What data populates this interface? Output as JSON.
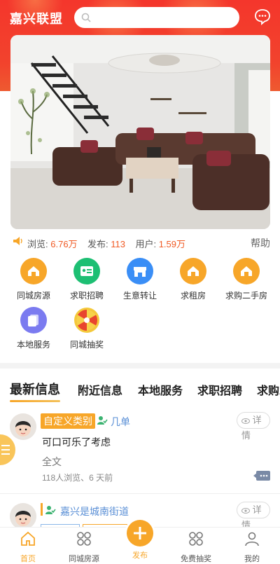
{
  "header": {
    "brand": "嘉兴联盟",
    "search_placeholder": "",
    "accent": "#f4362c"
  },
  "stats": {
    "views_label": "浏览:",
    "views_value": "6.76万",
    "posts_label": "发布:",
    "posts_value": "113",
    "users_label": "用户:",
    "users_value": "1.59万",
    "help": "帮助"
  },
  "categories": [
    {
      "label": "同城房源",
      "icon": "house-icon",
      "color": "#f7a629"
    },
    {
      "label": "求职招聘",
      "icon": "id-card-icon",
      "color": "#1dbf73"
    },
    {
      "label": "生意转让",
      "icon": "shop-icon",
      "color": "#3a8ef6"
    },
    {
      "label": "求租房",
      "icon": "house-icon",
      "color": "#f7a629"
    },
    {
      "label": "求购二手房",
      "icon": "house-icon",
      "color": "#f7a629"
    },
    {
      "label": "本地服务",
      "icon": "documents-icon",
      "color": "#7b7bf0"
    },
    {
      "label": "同城抽奖",
      "icon": "prize-wheel-icon",
      "color": "#e8452f"
    }
  ],
  "tabs": [
    "最新信息",
    "附近信息",
    "本地服务",
    "求职招聘",
    "求购二"
  ],
  "posts": [
    {
      "tag": "自定义类别",
      "author": "几单",
      "detail": "详情",
      "text": "可口可乐了考虑",
      "fulltext": "全文",
      "meta": "118人浏览、6 天前"
    },
    {
      "tag": "",
      "author": "嘉兴是城南街道",
      "detail": "详情"
    }
  ],
  "bottom_nav": [
    {
      "label": "首页",
      "icon": "home-icon",
      "active": true
    },
    {
      "label": "同城房源",
      "icon": "grid-icon"
    },
    {
      "label": "发布",
      "icon": "plus-icon"
    },
    {
      "label": "免费抽奖",
      "icon": "grid-icon"
    },
    {
      "label": "我的",
      "icon": "user-icon"
    }
  ]
}
